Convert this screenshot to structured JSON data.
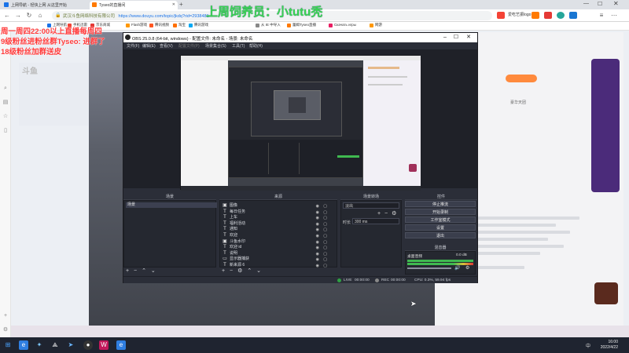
{
  "overlay": {
    "title": "上周饲养员：小tutu秃",
    "left_lines": [
      "周一周四22:00以上直播每周四",
      "9级粉丝进粉丝群Tyseo: 进群了",
      "18级粉丝加群送皮"
    ]
  },
  "browser": {
    "tabs": [
      {
        "label": "上网导航 - 轻快上网 从这里开始",
        "color": "#1a73e8",
        "active": false
      },
      {
        "label": "Tyseo的直播间",
        "color": "#ff7a00",
        "active": true
      }
    ],
    "new_tab": "+",
    "address_prefix": "武汉斗鱼网络科技有限公司",
    "address_url": "https://www.douyu.com/topic/jkdq?rid=2938481",
    "right_label": "爱吃艺振logo了",
    "bookmarks": [
      "上网导航",
      "手机迅雷",
      "京东商城",
      "Flash游戏",
      "腾讯视频",
      "淘宝",
      "腾讯游戏",
      "从 IE 中导入",
      "蕾姆Tyseo直播",
      "Скачать игры",
      "网游"
    ]
  },
  "douyu": {
    "room_num": "12",
    "logo": "斗鱼",
    "side_text": "豪华天团"
  },
  "obs": {
    "title": "OBS 25.0.8 (64-bit, windows) - 配置文件: 未命名 - 场景: 未命名",
    "menu": [
      "文件(F)",
      "编辑(E)",
      "查看(V)",
      "配置文件(P)",
      "场景集合(S)",
      "工具(T)",
      "帮助(H)"
    ],
    "docks": {
      "scenes": "场景",
      "sources": "来源",
      "mixer": "混音器",
      "transitions": "场景转场",
      "controls": "控件"
    },
    "scenes": [
      "场景"
    ],
    "sources": [
      {
        "icon": "▣",
        "label": "图像"
      },
      {
        "icon": "T",
        "label": "每日任务"
      },
      {
        "icon": "T",
        "label": "上车"
      },
      {
        "icon": "T",
        "label": "福利活动"
      },
      {
        "icon": "T",
        "label": "通知"
      },
      {
        "icon": "T",
        "label": "欢迎"
      },
      {
        "icon": "▣",
        "label": "斗鱼水印"
      },
      {
        "icon": "T",
        "label": "欢迎 id"
      },
      {
        "icon": "T",
        "label": "说明"
      },
      {
        "icon": "▭",
        "label": "显示器捕获"
      },
      {
        "icon": "T",
        "label": "新来源 6"
      }
    ],
    "transition_type": "淡出",
    "duration_label": "时长",
    "duration_value": "300 ms",
    "controls": [
      "停止推流",
      "开始录制",
      "工作室模式",
      "设置",
      "退出"
    ],
    "mixer_label": "桌面音频",
    "mixer_db": "0.0 dB",
    "status": {
      "live_label": "LIVE",
      "live_time": "00:00:00",
      "rec_label": "REC",
      "rec_time": "00:00:00",
      "cpu": "CPU: 0.3%, 59.94 fps"
    }
  },
  "taskbar": {
    "time": "16:00",
    "date": "2022/4/22",
    "lang": "中"
  },
  "colors": {
    "overlay_green": "#39d353",
    "overlay_red": "#ff3b3b",
    "obs_bg": "#2b2e38",
    "accent": "#ff7a00"
  }
}
